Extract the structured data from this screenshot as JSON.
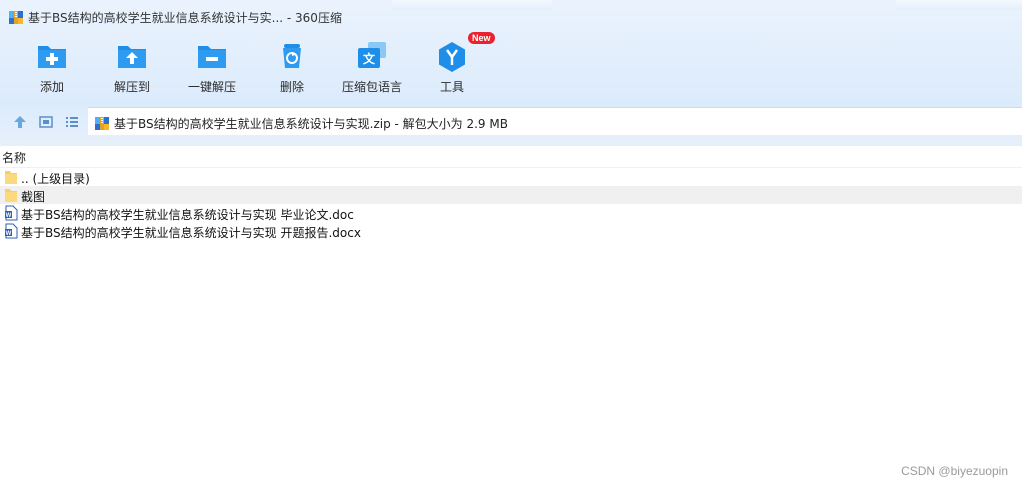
{
  "window": {
    "title": "基于BS结构的高校学生就业信息系统设计与实... - 360压缩",
    "app_icon": "archive-icon"
  },
  "toolbar": {
    "buttons": [
      {
        "label": "添加",
        "icon": "add-icon"
      },
      {
        "label": "解压到",
        "icon": "extract-to-icon"
      },
      {
        "label": "一键解压",
        "icon": "one-click-extract-icon"
      },
      {
        "label": "删除",
        "icon": "delete-icon"
      },
      {
        "label": "压缩包语言",
        "icon": "language-icon"
      },
      {
        "label": "工具",
        "icon": "tools-icon",
        "badge": "New"
      }
    ]
  },
  "address_bar": {
    "path": "基于BS结构的高校学生就业信息系统设计与实现.zip - 解包大小为 2.9 MB",
    "nav_icons": [
      "up-arrow-icon",
      "thumbnail-view-icon",
      "list-view-icon"
    ]
  },
  "file_list": {
    "column_header": "名称",
    "rows": [
      {
        "name": ".. (上级目录)",
        "type": "folder"
      },
      {
        "name": "截图",
        "type": "folder",
        "selected": true
      },
      {
        "name": "基于BS结构的高校学生就业信息系统设计与实现 毕业论文.doc",
        "type": "word"
      },
      {
        "name": "基于BS结构的高校学生就业信息系统设计与实现 开题报告.docx",
        "type": "word"
      }
    ]
  },
  "watermark": "CSDN @biyezuopin",
  "colors": {
    "accent_blue": "#1e8ee8",
    "badge_red": "#e8232f",
    "toolbar_bg": "#dcebfc"
  }
}
